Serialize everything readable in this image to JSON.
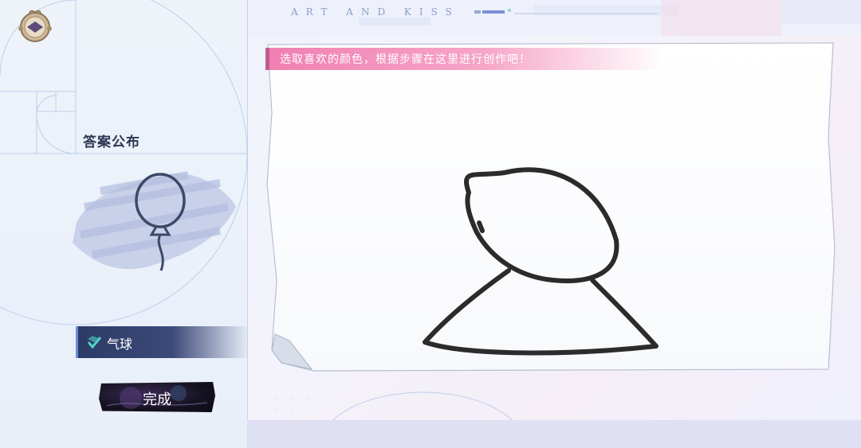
{
  "header": {
    "brand": "ART AND KISS"
  },
  "left_panel": {
    "answer_title": "答案公布",
    "answer_name": "气球",
    "done_label": "完成"
  },
  "canvas": {
    "instruction": "选取喜欢的颜色，根据步骤在这里进行创作吧！"
  },
  "colors": {
    "accent_pink": "#f07fb1",
    "tag_blue": "#2c3a66",
    "check_teal": "#4fd1c5",
    "stroke": "#2b2b2b"
  },
  "icons": [
    "menu-emblem-icon",
    "check-icon",
    "balloon-sketch-icon"
  ]
}
